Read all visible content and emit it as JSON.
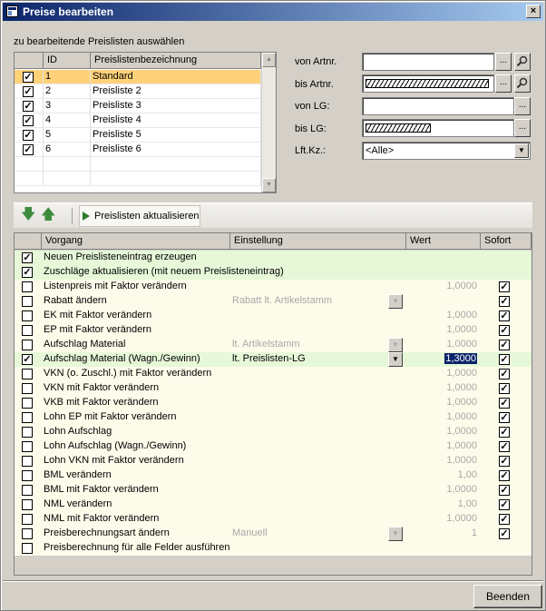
{
  "window": {
    "title": "Preise bearbeiten",
    "close_glyph": "×"
  },
  "section_label": "zu bearbeitende Preislisten auswählen",
  "pricelists": {
    "headers": [
      "ID",
      "Preislistenbezeichnung"
    ],
    "rows": [
      {
        "checked": true,
        "id": "1",
        "name": "Standard",
        "selected": true
      },
      {
        "checked": true,
        "id": "2",
        "name": "Preisliste 2"
      },
      {
        "checked": true,
        "id": "3",
        "name": "Preisliste 3"
      },
      {
        "checked": true,
        "id": "4",
        "name": "Preisliste 4"
      },
      {
        "checked": true,
        "id": "5",
        "name": "Preisliste 5"
      },
      {
        "checked": true,
        "id": "6",
        "name": "Preisliste 6"
      }
    ]
  },
  "filters": {
    "von_artnr": {
      "label": "von Artnr.",
      "value": ""
    },
    "bis_artnr": {
      "label": "bis Artnr.",
      "value": ""
    },
    "von_lg": {
      "label": "von LG:",
      "value": ""
    },
    "bis_lg": {
      "label": "bis LG:",
      "value": ""
    },
    "lft_kz": {
      "label": "Lft.Kz.:",
      "value": "<Alle>"
    },
    "dots": "..."
  },
  "toolbar": {
    "update_label": "Preislisten aktualisieren"
  },
  "main_grid": {
    "headers": {
      "vorgang": "Vorgang",
      "einstellung": "Einstellung",
      "wert": "Wert",
      "sofort": "Sofort"
    },
    "rows": [
      {
        "checked": true,
        "vorgang": "Neuen Preislisteneintrag erzeugen",
        "einstellung": "",
        "wert": "",
        "sofort": null,
        "highlight": true
      },
      {
        "checked": true,
        "vorgang": "Zuschläge aktualisieren (mit neuem Preislisteneintrag)",
        "einstellung": "",
        "wert": "",
        "sofort": null,
        "highlight": true
      },
      {
        "checked": false,
        "vorgang": "Listenpreis mit Faktor verändern",
        "einstellung": "",
        "wert": "1,0000",
        "sofort": true
      },
      {
        "checked": false,
        "vorgang": "Rabatt ändern",
        "einstellung": "Rabatt lt. Artikelstamm",
        "wert": "",
        "sofort": true,
        "dropdown": true
      },
      {
        "checked": false,
        "vorgang": "EK mit Faktor verändern",
        "einstellung": "",
        "wert": "1,0000",
        "sofort": true
      },
      {
        "checked": false,
        "vorgang": "EP mit Faktor verändern",
        "einstellung": "",
        "wert": "1,0000",
        "sofort": true
      },
      {
        "checked": false,
        "vorgang": "Aufschlag Material",
        "einstellung": "lt. Artikelstamm",
        "wert": "1,0000",
        "sofort": true,
        "dropdown": true
      },
      {
        "checked": true,
        "vorgang": "Aufschlag Material (Wagn./Gewinn)",
        "einstellung": "lt. Preislisten-LG",
        "wert": "1,3000",
        "sofort": true,
        "dropdown": true,
        "highlight": true,
        "active": true
      },
      {
        "checked": false,
        "vorgang": "VKN (o. Zuschl.) mit Faktor verändern",
        "einstellung": "",
        "wert": "1,0000",
        "sofort": true
      },
      {
        "checked": false,
        "vorgang": "VKN mit Faktor verändern",
        "einstellung": "",
        "wert": "1,0000",
        "sofort": true
      },
      {
        "checked": false,
        "vorgang": "VKB mit Faktor verändern",
        "einstellung": "",
        "wert": "1,0000",
        "sofort": true
      },
      {
        "checked": false,
        "vorgang": "Lohn EP mit Faktor verändern",
        "einstellung": "",
        "wert": "1,0000",
        "sofort": true
      },
      {
        "checked": false,
        "vorgang": "Lohn Aufschlag",
        "einstellung": "",
        "wert": "1,0000",
        "sofort": true
      },
      {
        "checked": false,
        "vorgang": "Lohn Aufschlag (Wagn./Gewinn)",
        "einstellung": "",
        "wert": "1,0000",
        "sofort": true
      },
      {
        "checked": false,
        "vorgang": "Lohn VKN mit Faktor verändern",
        "einstellung": "",
        "wert": "1,0000",
        "sofort": true
      },
      {
        "checked": false,
        "vorgang": "BML verändern",
        "einstellung": "",
        "wert": "1,00",
        "sofort": true
      },
      {
        "checked": false,
        "vorgang": "BML mit Faktor verändern",
        "einstellung": "",
        "wert": "1,0000",
        "sofort": true
      },
      {
        "checked": false,
        "vorgang": "NML verändern",
        "einstellung": "",
        "wert": "1,00",
        "sofort": true
      },
      {
        "checked": false,
        "vorgang": "NML mit Faktor verändern",
        "einstellung": "",
        "wert": "1,0000",
        "sofort": true
      },
      {
        "checked": false,
        "vorgang": "Preisberechnungsart ändern",
        "einstellung": "Manuell",
        "wert": "1",
        "sofort": true,
        "dropdown": true
      },
      {
        "checked": false,
        "vorgang": "Preisberechnung für alle Felder ausführen",
        "einstellung": "",
        "wert": "",
        "sofort": null
      }
    ]
  },
  "footer": {
    "close_label": "Beenden"
  }
}
